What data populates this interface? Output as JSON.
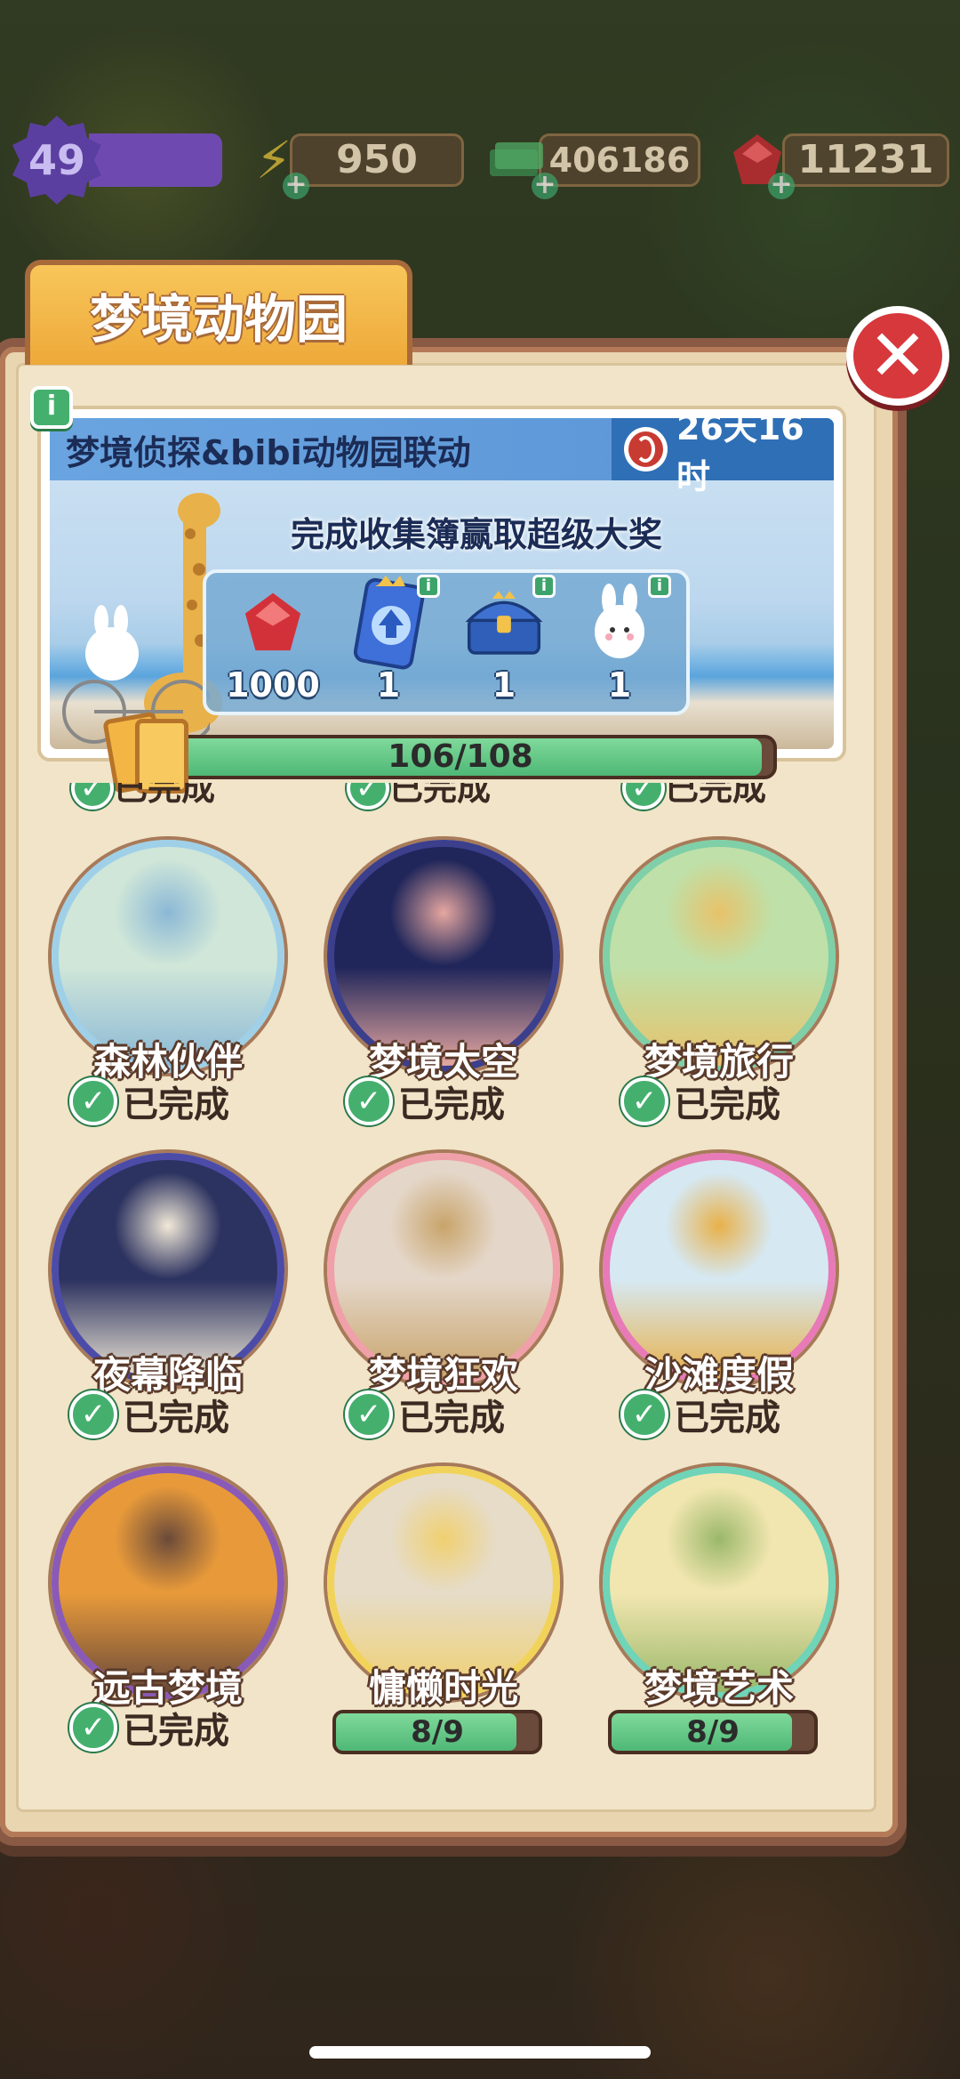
{
  "hud": {
    "level": "49",
    "energy": "950",
    "cash": "406186",
    "gems": "11231"
  },
  "panel": {
    "tab_title": "梦境动物园",
    "close_icon": "close-icon",
    "info_label": "i"
  },
  "banner": {
    "title": "梦境侦探&bibi动物园联动",
    "timer": "26天16时",
    "subtitle": "完成收集簿赢取超级大奖",
    "rewards": [
      {
        "icon": "ruby-gem-icon",
        "count": "1000",
        "has_info": false
      },
      {
        "icon": "blue-upgrade-card-icon",
        "count": "1",
        "has_info": true
      },
      {
        "icon": "treasure-chest-icon",
        "count": "1",
        "has_info": true
      },
      {
        "icon": "bunny-character-icon",
        "count": "1",
        "has_info": true
      }
    ]
  },
  "collection_progress": {
    "text": "106/108",
    "value": 106,
    "max": 108
  },
  "albums": [
    {
      "title": "森林伙伴",
      "status": "已完成",
      "completed": true,
      "ring": "#9fd0e8"
    },
    {
      "title": "梦境太空",
      "status": "已完成",
      "completed": true,
      "ring": "#3b3f8c"
    },
    {
      "title": "梦境旅行",
      "status": "已完成",
      "completed": true,
      "ring": "#7fcfa8"
    },
    {
      "title": "夜幕降临",
      "status": "已完成",
      "completed": true,
      "ring": "#4c4ca8"
    },
    {
      "title": "梦境狂欢",
      "status": "已完成",
      "completed": true,
      "ring": "#f0a0a8"
    },
    {
      "title": "沙滩度假",
      "status": "已完成",
      "completed": true,
      "ring": "#e87ab8"
    },
    {
      "title": "远古梦境",
      "status": "已完成",
      "completed": true,
      "ring": "#8a5ab8"
    },
    {
      "title": "慵懒时光",
      "status": "8/9",
      "completed": false,
      "progress": 8,
      "max": 9,
      "ring": "#f2d35a"
    },
    {
      "title": "梦境艺术",
      "status": "8/9",
      "completed": false,
      "progress": 8,
      "max": 9,
      "ring": "#6fd4b8"
    }
  ],
  "peek_row_status": "已完成"
}
